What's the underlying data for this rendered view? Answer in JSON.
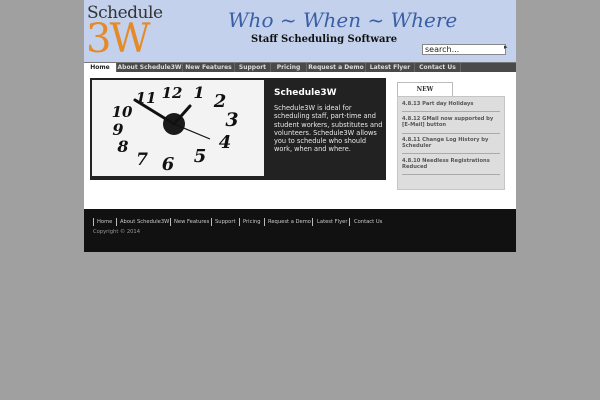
{
  "header": {
    "logo_top": "Schedule",
    "logo_bottom": "3W",
    "tagline": "Who ~ When ~ Where",
    "subtagline": "Staff Scheduling Software",
    "search_value": "search..."
  },
  "nav": [
    "Home",
    "About Schedule3W",
    "New Features",
    "Support",
    "Pricing",
    "Request a Demo",
    "Latest Flyer",
    "Contact Us"
  ],
  "feature": {
    "title": "Schedule3W",
    "text": "Schedule3W is ideal for scheduling staff, part-time and student workers, substitutes and volunteers. Schedule3W allows you to schedule who should work, when and where.",
    "clock_numbers": [
      "12",
      "1",
      "2",
      "3",
      "4",
      "5",
      "6",
      "7",
      "8",
      "9",
      "10",
      "11"
    ]
  },
  "sidebar": {
    "tab": "NEW FEATURES",
    "items": [
      "4.8.13 Part day Holidays",
      "4.8.12 GMail now supported by [E-Mail] button",
      "4.8.11 Change Log History by Scheduler",
      "4.8.10 Needless Registrations Reduced"
    ]
  },
  "footer": {
    "links": [
      "Home",
      "About Schedule3W",
      "New Features",
      "Support",
      "Pricing",
      "Request a Demo",
      "Latest Flyer",
      "Contact Us"
    ],
    "copyright": "Copyright © 2014"
  },
  "colors": {
    "header_bg": "#c3d1ec",
    "logo_accent": "#e58a28",
    "tagline": "#3a5fa5"
  }
}
